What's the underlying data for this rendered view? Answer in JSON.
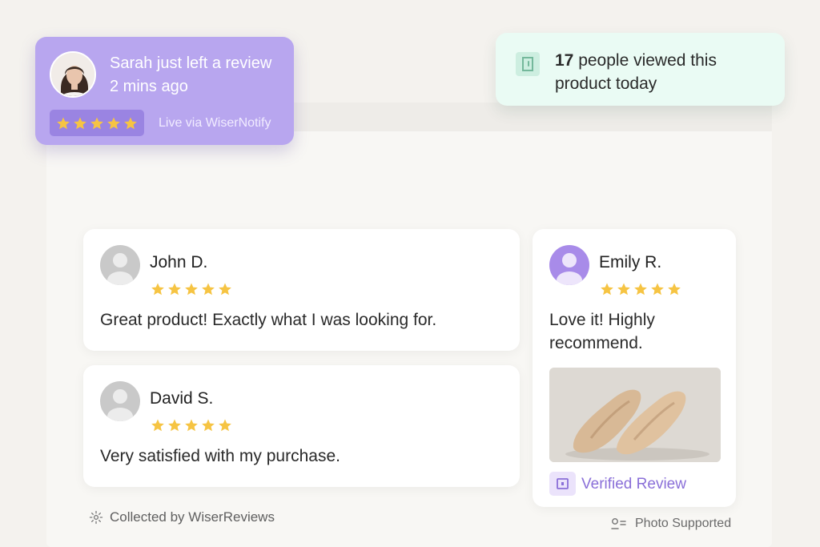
{
  "notification": {
    "title": "Sarah just left a review",
    "time": "2 mins ago",
    "rating": 5,
    "via": "Live via WiserNotify"
  },
  "views": {
    "count": "17",
    "text_line1": " people viewed this",
    "text_line2": "product today"
  },
  "reviews": [
    {
      "name": "John D.",
      "rating": 5,
      "text": "Great product! Exactly what I was looking for."
    },
    {
      "name": "David S.",
      "rating": 5,
      "text": "Very satisfied with my purchase."
    },
    {
      "name": "Emily R.",
      "rating": 5,
      "text_line1": "Love it! Highly",
      "text_line2": "recommend.",
      "verified": "Verified Review"
    }
  ],
  "footer": {
    "collected": "Collected by WiserReviews",
    "photo": "Photo Supported"
  },
  "colors": {
    "star": "#f6c443",
    "notification_bg": "#b8a6ef",
    "views_bg": "#eafbf4",
    "verified": "#8a6fd8"
  }
}
